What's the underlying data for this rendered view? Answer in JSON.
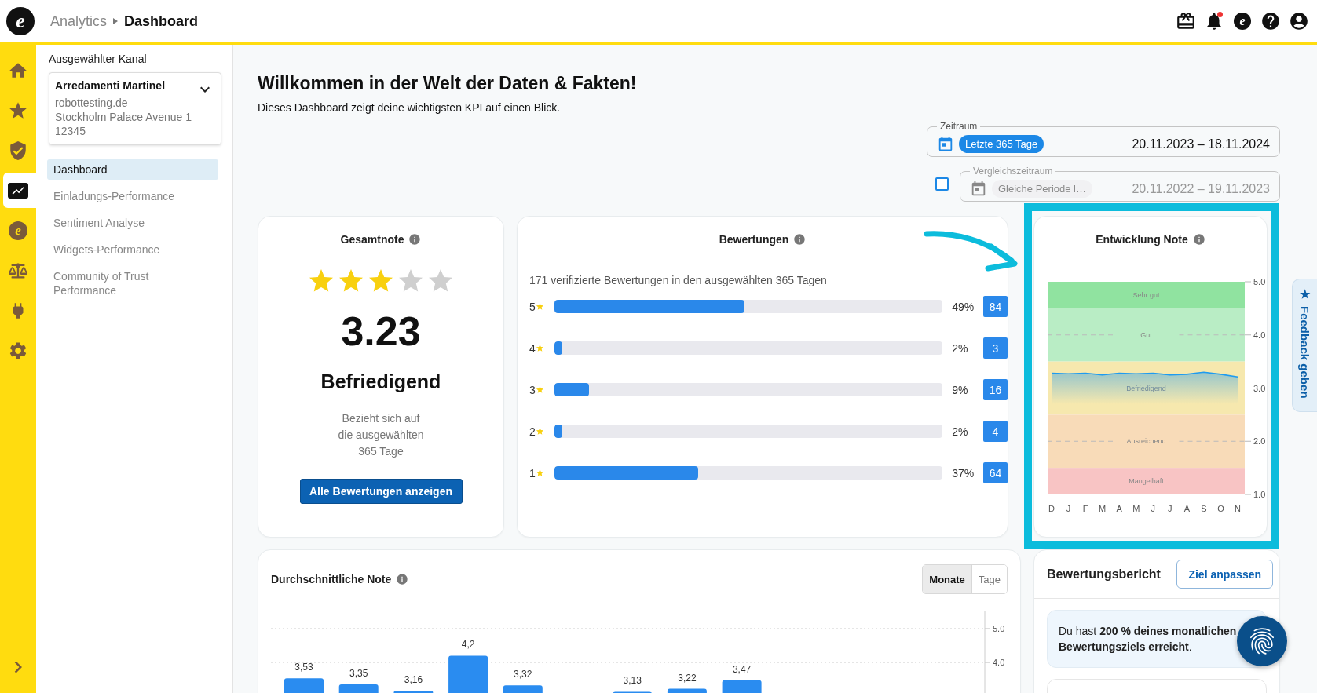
{
  "topbar": {
    "logo": "e",
    "breadcrumb": [
      {
        "label": "Analytics",
        "current": false
      },
      {
        "label": "Dashboard",
        "current": true
      }
    ],
    "actions": [
      {
        "kind": "gift"
      },
      {
        "kind": "bell",
        "badge": true
      },
      {
        "kind": "brand",
        "glyph": "e"
      },
      {
        "kind": "help"
      },
      {
        "kind": "account"
      }
    ]
  },
  "rail": {
    "items": [
      {
        "kind": "home",
        "selected": false
      },
      {
        "kind": "star",
        "selected": false
      },
      {
        "kind": "shield",
        "selected": false
      },
      {
        "kind": "chart",
        "selected": true
      },
      {
        "kind": "brand",
        "glyph": "e",
        "selected": false
      },
      {
        "kind": "scales",
        "selected": false
      },
      {
        "kind": "plug",
        "selected": false
      },
      {
        "kind": "gear",
        "selected": false
      }
    ]
  },
  "sidebar": {
    "label": "Ausgewählter Kanal",
    "channel": {
      "name": "Arredamenti Martinel",
      "lines": [
        "robottesting.de",
        "Stockholm Palace Avenue 1",
        "12345"
      ]
    },
    "nav": [
      {
        "label": "Dashboard",
        "selected": true
      },
      {
        "label": "Einladungs-Performance",
        "selected": false
      },
      {
        "label": "Sentiment Analyse",
        "selected": false
      },
      {
        "label": "Widgets-Performance",
        "selected": false
      },
      {
        "label": "Community of Trust Performance",
        "selected": false
      }
    ]
  },
  "header": {
    "title": "Willkommen in der Welt der Daten & Fakten!",
    "subtitle": "Dieses Dashboard zeigt deine wichtigsten KPI auf einen Blick."
  },
  "period": {
    "legend": "Zeitraum",
    "chip": "Letzte 365 Tage",
    "range": "20.11.2023 – 18.11.2024"
  },
  "comparison": {
    "checked": false,
    "disabled": true,
    "legend": "Vergleichszeitraum",
    "chip": "Gleiche Periode l…",
    "range": "20.11.2022 – 19.11.2023"
  },
  "overall": {
    "title": "Gesamtnote",
    "stars": 3,
    "score": "3.23",
    "grade": "Befriedigend",
    "note_lines": [
      "Bezieht sich auf",
      "die ausgewählten",
      "365 Tage"
    ],
    "button": "Alle Bewertungen anzeigen"
  },
  "reviews": {
    "title": "Bewertungen",
    "summary": "171 verifizierte Bewertungen in den ausgewählten 365 Tagen",
    "rows": [
      {
        "rating": "5",
        "percent": "49%",
        "count": "84",
        "level": 0.49
      },
      {
        "rating": "4",
        "percent": "2%",
        "count": "3",
        "level": 0.02
      },
      {
        "rating": "3",
        "percent": "9%",
        "count": "16",
        "level": 0.09
      },
      {
        "rating": "2",
        "percent": "2%",
        "count": "4",
        "level": 0.02
      },
      {
        "rating": "1",
        "percent": "37%",
        "count": "64",
        "level": 0.37
      }
    ]
  },
  "trend": {
    "title": "Entwicklung Note",
    "chart_data": {
      "type": "area",
      "x": [
        "D",
        "J",
        "F",
        "M",
        "A",
        "M",
        "J",
        "J",
        "A",
        "S",
        "O",
        "N"
      ],
      "series": [
        {
          "color": "#1e9bf0",
          "values": [
            3.28,
            3.27,
            3.28,
            3.25,
            3.28,
            3.27,
            3.28,
            3.25,
            3.26,
            3.3,
            3.26,
            3.21
          ]
        }
      ],
      "ylim": [
        1,
        5
      ],
      "yticks": [
        {
          "value": 1,
          "label": "1.0"
        },
        {
          "value": 2,
          "label": "2.0"
        },
        {
          "value": 3,
          "label": "3.0"
        },
        {
          "value": 4,
          "label": "4.0"
        },
        {
          "value": 5,
          "label": "5.0"
        }
      ],
      "ref_lines": [
        {
          "axis": "y",
          "value": 4
        },
        {
          "axis": "y",
          "value": 3
        },
        {
          "axis": "y",
          "value": 2
        }
      ],
      "bands": [
        {
          "label": "Sehr gut",
          "axis": "y",
          "from": 4.5,
          "to": 5,
          "color": "#90e3a0"
        },
        {
          "label": "Gut",
          "axis": "y",
          "from": 3.5,
          "to": 4.5,
          "color": "#b9edc5"
        },
        {
          "label": "Befriedigend",
          "axis": "y",
          "from": 2.5,
          "to": 3.5,
          "color": "#f6e8ae"
        },
        {
          "label": "Ausreichend",
          "axis": "y",
          "from": 1.5,
          "to": 2.5,
          "color": "#f8dbb8"
        },
        {
          "label": "Mangelhaft",
          "axis": "y",
          "from": 1,
          "to": 1.5,
          "color": "#f8c4c4"
        }
      ]
    }
  },
  "average": {
    "title": "Durchschnittliche Note",
    "toggle": [
      {
        "label": "Monate",
        "selected": true
      },
      {
        "label": "Tage",
        "selected": false
      }
    ],
    "chart_data": {
      "type": "bar",
      "values": [
        3.53,
        3.35,
        3.16,
        4.2,
        3.32,
        null,
        3.13,
        3.22,
        3.47,
        null,
        null,
        null,
        null
      ],
      "value_labels": [
        "3,53",
        "3,35",
        "3,16",
        "4,2",
        "3,32",
        null,
        "3,13",
        "3,22",
        "3,47",
        null,
        null,
        null,
        null
      ],
      "ylim": [
        0,
        5
      ],
      "yticks": [
        {
          "value": 4,
          "label": "4.0"
        },
        {
          "value": 5,
          "label": "5.0"
        }
      ]
    }
  },
  "report": {
    "title": "Bewertungsbericht",
    "button": "Ziel anpassen",
    "message": "Du hast **200 % deines monatlichen Bewertungsziels erreicht**."
  },
  "feedback": {
    "icon": "★",
    "label": "Feedback geben"
  }
}
